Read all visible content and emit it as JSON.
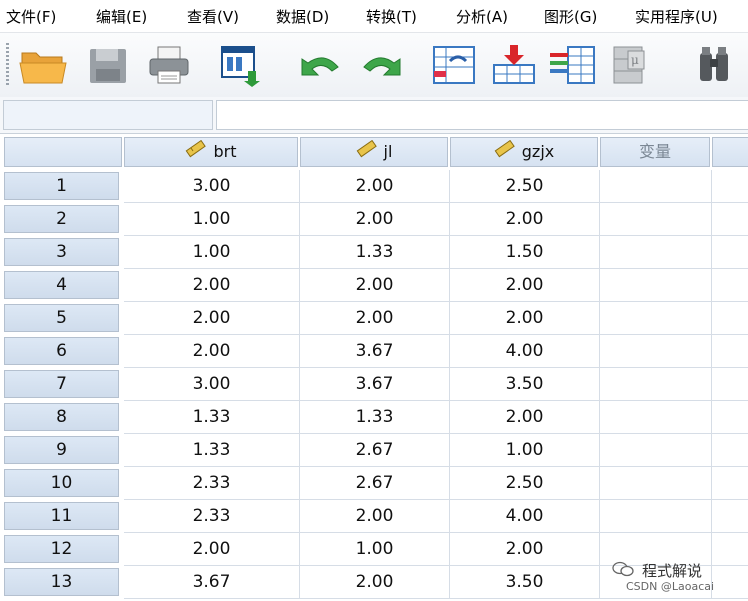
{
  "menu": [
    "文件(F)",
    "编辑(E)",
    "查看(V)",
    "数据(D)",
    "转换(T)",
    "分析(A)",
    "图形(G)",
    "实用程序(U)"
  ],
  "toolbar": {
    "buttons": [
      {
        "name": "open-folder-icon"
      },
      {
        "name": "save-icon"
      },
      {
        "name": "print-icon"
      },
      {
        "name": "dialog-recall-icon"
      },
      {
        "name": "undo-icon"
      },
      {
        "name": "redo-icon"
      },
      {
        "name": "goto-case-icon"
      },
      {
        "name": "goto-variable-icon"
      },
      {
        "name": "variables-icon"
      },
      {
        "name": "value-labels-icon"
      },
      {
        "name": "find-icon"
      }
    ]
  },
  "editor": {
    "cell_ref": "",
    "cell_value": ""
  },
  "grid": {
    "columns": [
      "brt",
      "jl",
      "gzjx",
      "变量"
    ],
    "rows": [
      {
        "num": "1",
        "cells": [
          "3.00",
          "2.00",
          "2.50"
        ]
      },
      {
        "num": "2",
        "cells": [
          "1.00",
          "2.00",
          "2.00"
        ]
      },
      {
        "num": "3",
        "cells": [
          "1.00",
          "1.33",
          "1.50"
        ]
      },
      {
        "num": "4",
        "cells": [
          "2.00",
          "2.00",
          "2.00"
        ]
      },
      {
        "num": "5",
        "cells": [
          "2.00",
          "2.00",
          "2.00"
        ]
      },
      {
        "num": "6",
        "cells": [
          "2.00",
          "3.67",
          "4.00"
        ]
      },
      {
        "num": "7",
        "cells": [
          "3.00",
          "3.67",
          "3.50"
        ]
      },
      {
        "num": "8",
        "cells": [
          "1.33",
          "1.33",
          "2.00"
        ]
      },
      {
        "num": "9",
        "cells": [
          "1.33",
          "2.67",
          "1.00"
        ]
      },
      {
        "num": "10",
        "cells": [
          "2.33",
          "2.67",
          "2.50"
        ]
      },
      {
        "num": "11",
        "cells": [
          "2.33",
          "2.00",
          "4.00"
        ]
      },
      {
        "num": "12",
        "cells": [
          "2.00",
          "1.00",
          "2.00"
        ]
      },
      {
        "num": "13",
        "cells": [
          "3.67",
          "2.00",
          "3.50"
        ]
      }
    ]
  },
  "watermark": {
    "line1": "程式解说",
    "line2": "CSDN @Laoacai"
  },
  "colors": {
    "header_bg": "#d6e2f1",
    "row_header_bg": "#cfdcec",
    "grid_line": "#d6dde6"
  }
}
